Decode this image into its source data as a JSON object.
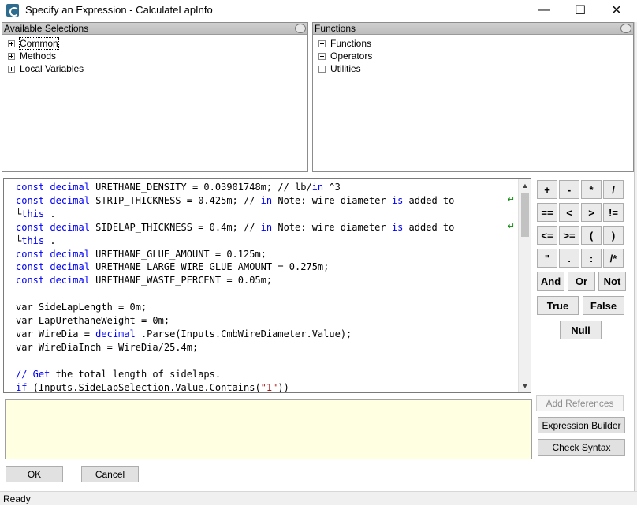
{
  "window": {
    "title": "Specify an Expression - CalculateLapInfo",
    "controls": {
      "minimize": "—",
      "maximize": "☐",
      "close": "✕"
    }
  },
  "available_selections": {
    "header": "Available Selections",
    "items": [
      {
        "label": "Common"
      },
      {
        "label": "Methods"
      },
      {
        "label": "Local Variables"
      }
    ]
  },
  "functions": {
    "header": "Functions",
    "items": [
      {
        "label": "Functions"
      },
      {
        "label": "Operators"
      },
      {
        "label": "Utilities"
      }
    ]
  },
  "code_lines": [
    [
      [
        "kw",
        "const "
      ],
      [
        "kw",
        "decimal"
      ],
      [
        "",
        "URETHANE_DENSITY = 0.03901748m; // lb/"
      ],
      [
        "kw",
        "in"
      ],
      [
        "",
        "^3"
      ]
    ],
    [
      [
        "kw",
        "const "
      ],
      [
        "kw",
        "decimal"
      ],
      [
        "",
        "STRIP_THICKNESS = 0.425m; // "
      ],
      [
        "kw",
        "in"
      ],
      [
        "",
        "Note: wire diameter "
      ],
      [
        "kw",
        "is"
      ],
      [
        "",
        "added to"
      ]
    ],
    [
      [
        "cont",
        "└"
      ],
      [
        "kw",
        "this"
      ],
      [
        "",
        "."
      ]
    ],
    [
      [
        "kw",
        "const "
      ],
      [
        "kw",
        "decimal"
      ],
      [
        "",
        "SIDELAP_THICKNESS = 0.4m; // "
      ],
      [
        "kw",
        "in"
      ],
      [
        "",
        "Note: wire diameter "
      ],
      [
        "kw",
        "is"
      ],
      [
        "",
        "added to"
      ]
    ],
    [
      [
        "cont",
        "└"
      ],
      [
        "kw",
        "this"
      ],
      [
        "",
        "."
      ]
    ],
    [
      [
        "kw",
        "const "
      ],
      [
        "kw",
        "decimal"
      ],
      [
        "",
        "URETHANE_GLUE_AMOUNT = 0.125m;"
      ]
    ],
    [
      [
        "kw",
        "const "
      ],
      [
        "kw",
        "decimal"
      ],
      [
        "",
        "URETHANE_LARGE_WIRE_GLUE_AMOUNT = 0.275m;"
      ]
    ],
    [
      [
        "kw",
        "const "
      ],
      [
        "kw",
        "decimal"
      ],
      [
        "",
        "URETHANE_WASTE_PERCENT = 0.05m;"
      ]
    ],
    [
      [
        "",
        ""
      ]
    ],
    [
      [
        "",
        "var SideLapLength = 0m;"
      ]
    ],
    [
      [
        "",
        "var LapUrethaneWeight = 0m;"
      ]
    ],
    [
      [
        "",
        "var WireDia = "
      ],
      [
        "kw",
        "decimal"
      ],
      [
        "",
        ".Parse(Inputs.CmbWireDiameter.Value);"
      ]
    ],
    [
      [
        "",
        "var WireDiaInch = WireDia/25.4m;"
      ]
    ],
    [
      [
        "",
        ""
      ]
    ],
    [
      [
        "kw",
        "// Get"
      ],
      [
        "",
        ""
      ],
      [
        "",
        "the total length of sidelaps."
      ]
    ],
    [
      [
        "kw",
        "if"
      ],
      [
        "",
        ""
      ],
      [
        "",
        "(Inputs.SideLapSelection.Value.Contains("
      ],
      [
        "str",
        "\"1\""
      ],
      [
        "",
        "))"
      ]
    ]
  ],
  "wrap_glyph": "↵",
  "keypad": {
    "row1": [
      "+",
      "-",
      "*",
      "/"
    ],
    "row2": [
      "==",
      "<",
      ">",
      "!="
    ],
    "row3": [
      "<=",
      ">=",
      "(",
      ")"
    ],
    "row4": [
      "\"",
      ".",
      ":",
      "/*"
    ],
    "row5": [
      "And",
      "Or",
      "Not"
    ],
    "row6": [
      "True",
      "False"
    ],
    "row7": [
      "Null"
    ]
  },
  "side_buttons": {
    "add_references": "Add References",
    "expression_builder": "Expression Builder",
    "check_syntax": "Check Syntax"
  },
  "footer": {
    "ok": "OK",
    "cancel": "Cancel",
    "status": "Ready"
  }
}
